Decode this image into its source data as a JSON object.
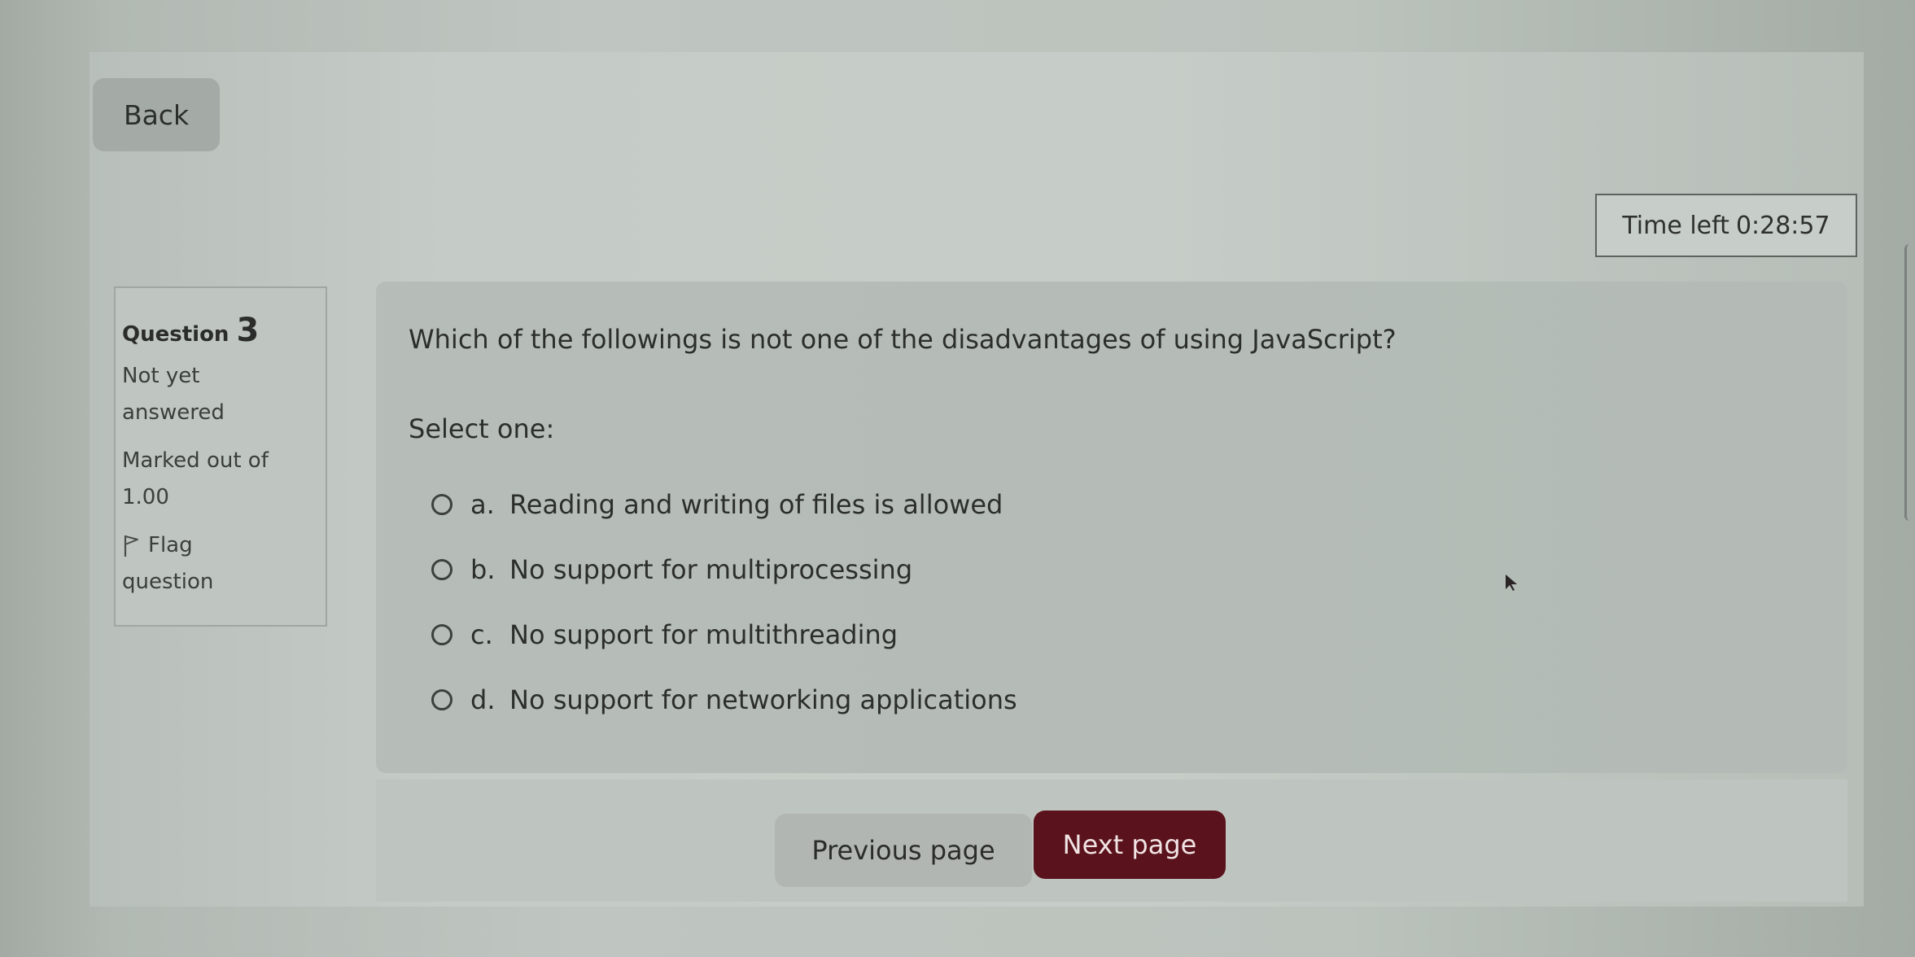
{
  "header": {
    "back_label": "Back",
    "timer_label": "Time left",
    "timer_value": "0:28:57"
  },
  "question_info": {
    "question_word": "Question",
    "question_number": "3",
    "status": "Not yet answered",
    "status_line1": "Not yet",
    "status_line2": "answered",
    "marked_line1": "Marked out of",
    "marked_line2": "1.00",
    "flag_line1": "Flag",
    "flag_line2": "question",
    "flag_icon": "flag-icon"
  },
  "question": {
    "text": "Which of the followings is not one of the disadvantages of using JavaScript?",
    "prompt": "Select one:",
    "answers": [
      {
        "letter": "a.",
        "text": "Reading and writing of files is allowed",
        "selected": false
      },
      {
        "letter": "b.",
        "text": "No support for multiprocessing",
        "selected": false
      },
      {
        "letter": "c.",
        "text": "No support for multithreading",
        "selected": false
      },
      {
        "letter": "d.",
        "text": "No support for networking applications",
        "selected": false
      }
    ]
  },
  "navigation": {
    "previous_label": "Previous page",
    "next_label": "Next page"
  },
  "colors": {
    "accent": "#5a121c",
    "page_background": "#c5cbc6",
    "content_background": "#b6bdb8"
  }
}
